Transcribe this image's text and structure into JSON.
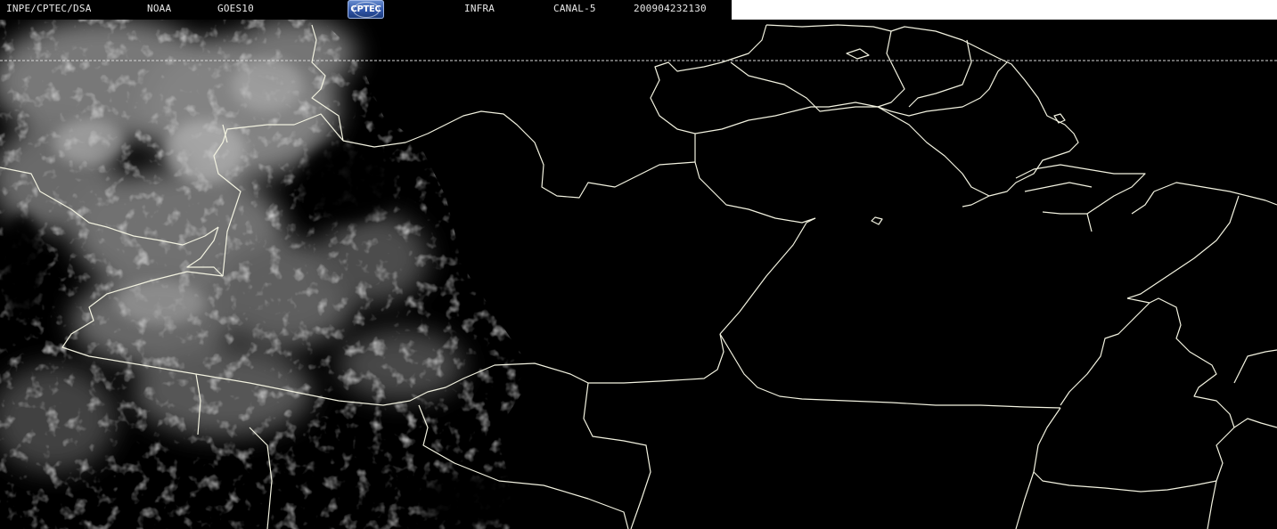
{
  "header": {
    "source": "INPE/CPTEC/DSA",
    "agency": "NOAA",
    "satellite": "GOES10",
    "logo_text": "CPTEC",
    "band": "INFRA",
    "channel": "CANAL-5",
    "timestamp": "200904232130"
  },
  "colors": {
    "background": "#000000",
    "header_text": "#e8e8e8",
    "borders": "#ffffff",
    "logo": "#2f55a8",
    "clouds": "#9a9a9a"
  }
}
